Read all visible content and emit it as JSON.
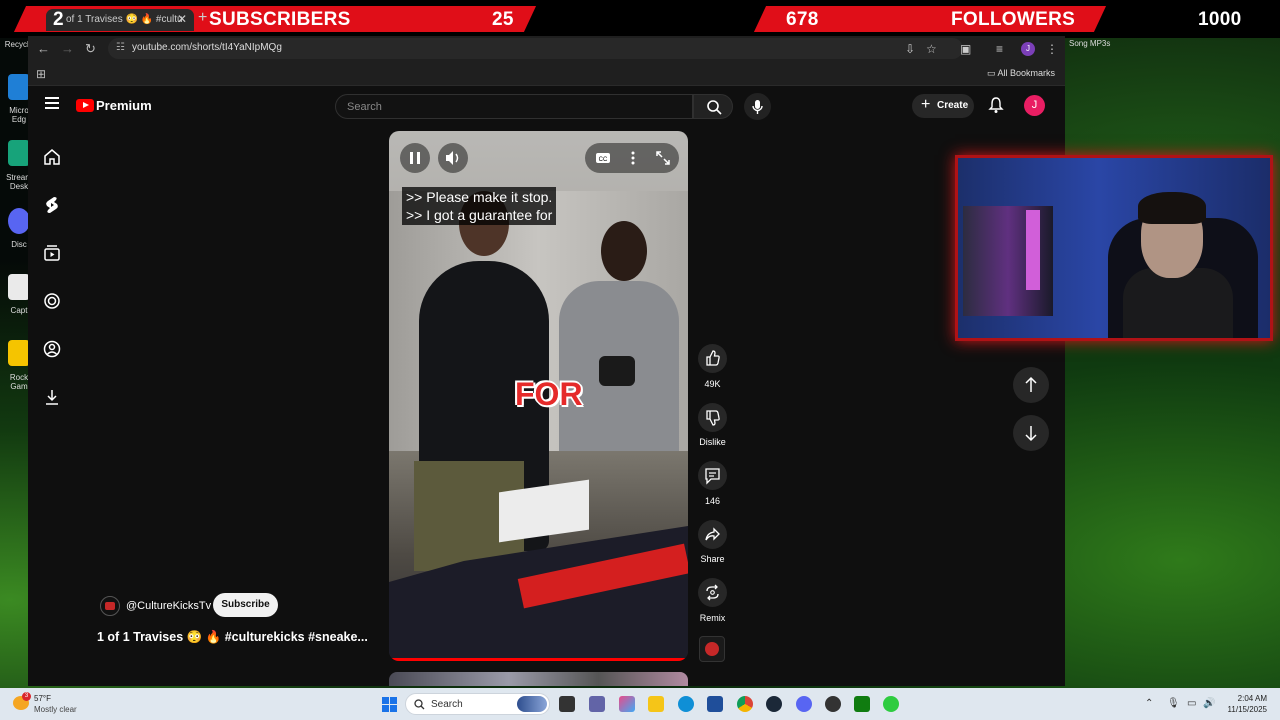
{
  "overlay": {
    "left_count": "2",
    "subscribers_label": "SUBSCRIBERS",
    "subscribers_goal": "25",
    "followers_current": "678",
    "followers_label": "FOLLOWERS",
    "followers_goal": "1000",
    "tab_title": "of 1 Travises 😳 🔥 #cultu"
  },
  "desktop": {
    "icons": [
      "Recycle",
      "Micro Edg",
      "Stream Desk",
      "Disc",
      "Capt",
      "Rock Gam"
    ],
    "song_label": "Song MP3s"
  },
  "browser": {
    "url": "youtube.com/shorts/tI4YaNIpMQg",
    "all_bookmarks": "All Bookmarks",
    "profile_initial": "J"
  },
  "youtube": {
    "brand": "Premium",
    "search_placeholder": "Search",
    "create_label": "Create",
    "user_initial": "J",
    "sidebar_icons": [
      "home-icon",
      "shorts-icon",
      "subscriptions-icon",
      "explore-icon",
      "you-icon",
      "downloads-icon"
    ]
  },
  "video": {
    "captions": [
      ">> Please make it stop.",
      ">> I got a guarantee for"
    ],
    "overlay_word": "FOR"
  },
  "actions": {
    "like_count": "49K",
    "dislike_label": "Dislike",
    "comment_count": "146",
    "share_label": "Share",
    "remix_label": "Remix"
  },
  "channel": {
    "name": "@CultureKicksTv",
    "subscribe_label": "Subscribe",
    "short_title": "1 of 1 Travises 😳 🔥 #culturekicks #sneake..."
  },
  "taskbar": {
    "weather_temp": "57°F",
    "weather_desc": "Mostly clear",
    "weather_badge": "3",
    "search_label": "Search",
    "time": "2:04 AM",
    "date": "11/15/2025"
  },
  "colors": {
    "overlay_red": "#e00e18",
    "yt_red": "#ff0000",
    "avatar_pink": "#e91e63",
    "webcam_border": "#b01216"
  }
}
